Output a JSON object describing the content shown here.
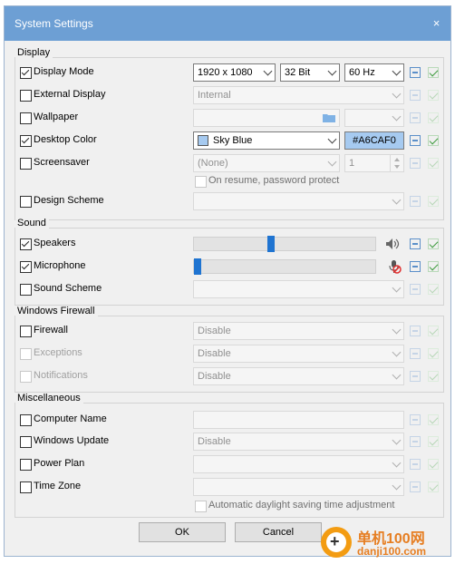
{
  "window": {
    "title": "System Settings",
    "close_glyph": "×"
  },
  "display": {
    "title": "Display",
    "display_mode": {
      "label": "Display Mode",
      "checked": true,
      "resolution": "1920 x 1080",
      "depth": "32 Bit",
      "refresh": "60 Hz"
    },
    "external_display": {
      "label": "External Display",
      "checked": false,
      "value": "Internal"
    },
    "wallpaper": {
      "label": "Wallpaper",
      "checked": false,
      "value": "",
      "second_value": ""
    },
    "desktop_color": {
      "label": "Desktop Color",
      "checked": true,
      "value": "Sky Blue",
      "hex": "#A6CAF0",
      "swatch_color": "#A6CAF0"
    },
    "screensaver": {
      "label": "Screensaver",
      "checked": false,
      "value": "(None)",
      "minutes": "1",
      "resume_label": "On resume, password protect",
      "resume_checked": false
    },
    "design_scheme": {
      "label": "Design Scheme",
      "checked": false,
      "value": ""
    }
  },
  "sound": {
    "title": "Sound",
    "speakers": {
      "label": "Speakers",
      "checked": true,
      "volume_fraction": 0.42,
      "icon": "speaker-icon"
    },
    "microphone": {
      "label": "Microphone",
      "checked": true,
      "volume_fraction": 0.0,
      "icon": "microphone-muted-icon"
    },
    "sound_scheme": {
      "label": "Sound Scheme",
      "checked": false,
      "value": ""
    }
  },
  "firewall": {
    "title": "Windows Firewall",
    "firewall": {
      "label": "Firewall",
      "checked": false,
      "value": "Disable"
    },
    "exceptions": {
      "label": "Exceptions",
      "checked": false,
      "value": "Disable"
    },
    "notifications": {
      "label": "Notifications",
      "checked": false,
      "value": "Disable"
    }
  },
  "misc": {
    "title": "Miscellaneous",
    "computer_name": {
      "label": "Computer Name",
      "checked": false,
      "value": ""
    },
    "windows_update": {
      "label": "Windows Update",
      "checked": false,
      "value": "Disable"
    },
    "power_plan": {
      "label": "Power Plan",
      "checked": false,
      "value": ""
    },
    "time_zone": {
      "label": "Time Zone",
      "checked": false,
      "value": "",
      "dst_label": "Automatic daylight saving time adjustment",
      "dst_checked": false
    }
  },
  "buttons": {
    "ok": "OK",
    "cancel": "Cancel"
  },
  "watermark": {
    "site_cn": "单机100网",
    "url": "danji100.com",
    "plus": "+"
  },
  "colors": {
    "titlebar": "#6d9fd4",
    "slider_thumb": "#1f74d1",
    "apply_icon": "#5b8fc9",
    "ok_icon": "#3c9a3c"
  }
}
